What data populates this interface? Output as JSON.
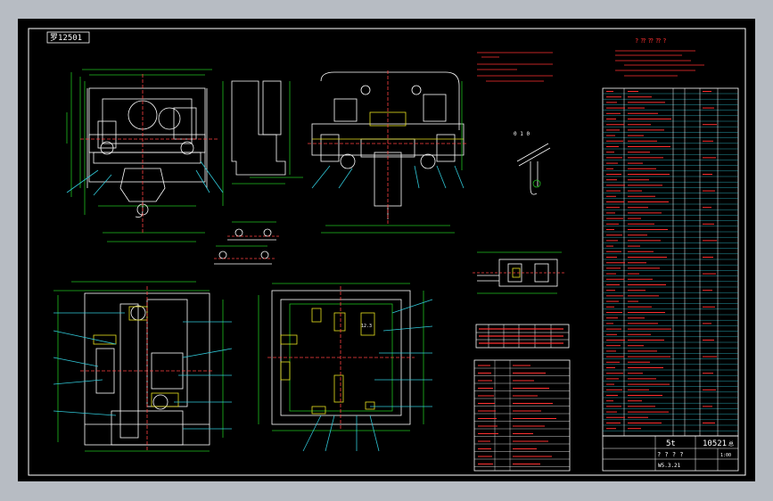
{
  "sheet": {
    "corner_label": "罗12501",
    "title_block": {
      "capacity": "5t",
      "drawing_no": "10521",
      "suffix": "总",
      "placeholder": "? ? ? ?",
      "scale_code": "W5.3.21",
      "page_mark": "1:00"
    },
    "parts_list_header": "? ? ? ?",
    "notes_header": "? ? ? ?",
    "detail_label": "0 1 0",
    "rotate_label": "12.3"
  },
  "colors": {
    "background": "#000000",
    "frame": "#ffffff",
    "outline": "#ffffff",
    "dimension": "#20c020",
    "centerline": "#ff4040",
    "text_red": "#ff3030",
    "table_cyan": "#30c8d8",
    "accent_yellow": "#e8e020"
  }
}
